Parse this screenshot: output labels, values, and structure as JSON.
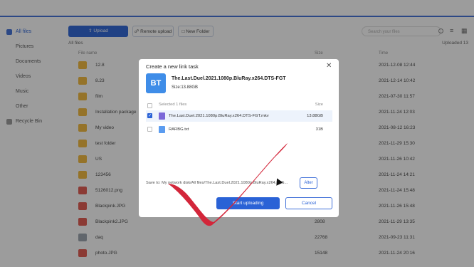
{
  "sidebar": {
    "items": [
      {
        "label": "All files",
        "icon": "folder-icon",
        "active": true
      },
      {
        "label": "Pictures"
      },
      {
        "label": "Documents"
      },
      {
        "label": "Videos"
      },
      {
        "label": "Music"
      },
      {
        "label": "Other"
      },
      {
        "label": "Recycle Bin",
        "icon": "recycle-bin-icon"
      }
    ]
  },
  "toolbar": {
    "upload_label": "Upload",
    "remote_label": "Remote upload",
    "newfolder_label": "New Folder",
    "search_placeholder": "Search your files",
    "breadcrumb": "All files",
    "uploaded_count": "Uploaded 13"
  },
  "table": {
    "headers": {
      "name": "File name",
      "size": "Size",
      "time": "Time"
    },
    "rows": [
      {
        "name": "12.8",
        "size": "",
        "time": "2021-12-08 12:44",
        "type": "folder"
      },
      {
        "name": "8.23",
        "size": "",
        "time": "2021-12-14 10:42",
        "type": "folder"
      },
      {
        "name": "film",
        "size": "",
        "time": "2021-07-30 11:57",
        "type": "folder"
      },
      {
        "name": "Installation package",
        "size": "",
        "time": "2021-11-24 12:03",
        "type": "folder"
      },
      {
        "name": "My video",
        "size": "",
        "time": "2021-08-12 16:23",
        "type": "folder"
      },
      {
        "name": "test folder",
        "size": "",
        "time": "2021-11-29 15:30",
        "type": "folder"
      },
      {
        "name": "US",
        "size": "",
        "time": "2021-11-26 10:42",
        "type": "folder"
      },
      {
        "name": "123456",
        "size": "",
        "time": "2021-11-24 14:21",
        "type": "folder"
      },
      {
        "name": "5126012.png",
        "size": "",
        "time": "2021-11-24 15:48",
        "type": "image"
      },
      {
        "name": "Blackpink.JPG",
        "size": "",
        "time": "2021-11-26 15:48",
        "type": "image"
      },
      {
        "name": "Blackpink2.JPG",
        "size": "2808",
        "time": "2021-11-29 13:35",
        "type": "image"
      },
      {
        "name": "daq",
        "size": "22768",
        "time": "2021-09-23 11:31",
        "type": "file"
      },
      {
        "name": "photo.JPG",
        "size": "15148",
        "time": "2021-11-24 20:16",
        "type": "image"
      }
    ]
  },
  "modal": {
    "title": "Create a new link task",
    "badge": "BT",
    "file_title": "The.Last.Duel.2021.1080p.BluRay.x264.DTS-FGT",
    "file_size": "Size:13.88GB",
    "selected_header": "Selected 1 files",
    "size_header": "Size",
    "files": [
      {
        "name": "The.Last.Duel.2021.1080p.BluRay.x264.DTS-FGT.mkv",
        "size": "13.88GB",
        "checked": true
      },
      {
        "name": "RARBG.txt",
        "size": "31B",
        "checked": false
      }
    ],
    "save_to": "Save to:   My network disk/All files/The.Last.Duel.2021.1080p.BluRay.x264.DTS...",
    "alter_label": "Alter",
    "start_label": "Start uploading",
    "cancel_label": "Cancel"
  },
  "colors": {
    "accent": "#2a62d6",
    "folder": "#f3b93a",
    "checkmark": "#d3263a"
  }
}
